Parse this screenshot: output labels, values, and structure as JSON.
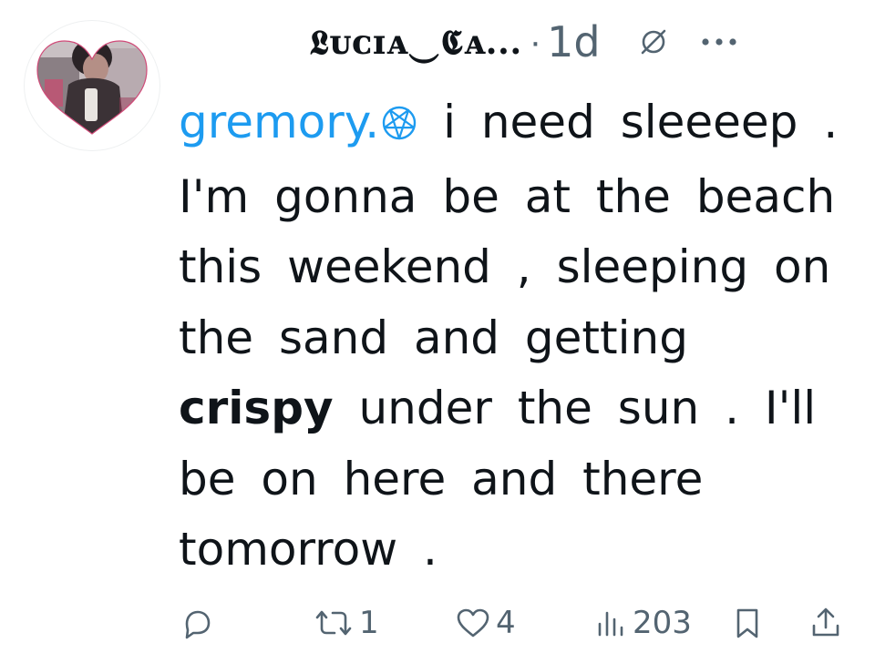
{
  "author": {
    "display_name": "𝕷ᴜᴄɪᴀ‿𝕮ᴀ...",
    "separator": "·",
    "time": "1d"
  },
  "post": {
    "mention": "gremory.",
    "text_1": " i need sleeeep . I'm gonna be at the beach this weekend , sleeping on the sand and getting ",
    "bold_word": "crispy",
    "text_2": " under the sun . I'll be on here and there tomorrow ."
  },
  "actions": {
    "reply_count": "",
    "repost_count": "1",
    "like_count": "4",
    "view_count": "203"
  },
  "icons": {
    "header": [
      "muted-icon",
      "more-icon"
    ],
    "actions": [
      "reply-icon",
      "repost-icon",
      "like-icon",
      "views-icon",
      "bookmark-icon",
      "share-icon"
    ]
  },
  "colors": {
    "text": "#0f1419",
    "secondary": "#536471",
    "mention": "#1d9bf0"
  }
}
